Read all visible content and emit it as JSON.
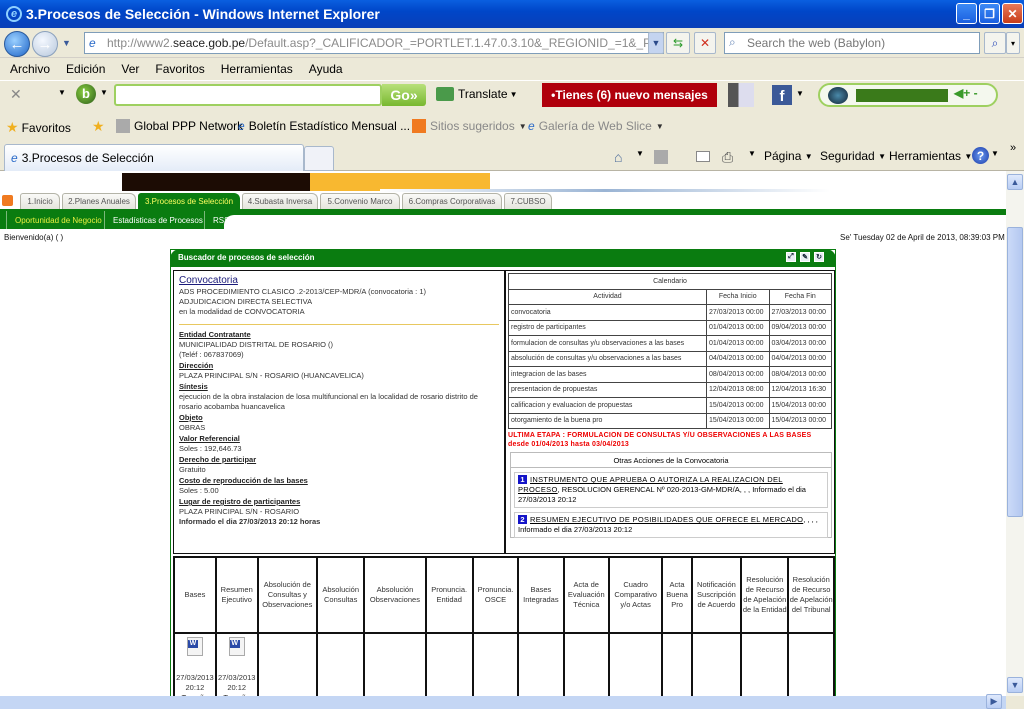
{
  "window": {
    "title": "3.Procesos de Selección - Windows Internet Explorer",
    "minimize": "_",
    "restore": "❐",
    "close": "✕"
  },
  "address": {
    "url_prefix": "http://www2.",
    "url_host": "seace.gob.pe",
    "url_rest": "/Default.asp?_CALIFICADOR_=PORTLET.1.47.0.3.10&_REGIONID_=1&_PORTLETI",
    "search_placeholder": "Search the web (Babylon)"
  },
  "menu": [
    "Archivo",
    "Edición",
    "Ver",
    "Favoritos",
    "Herramientas",
    "Ayuda"
  ],
  "babylon": {
    "go_label": "Go»",
    "translate_label": "Translate",
    "messages_label": "•Tienes (6) nuevo mensajes"
  },
  "favorites": {
    "favoritos_label": "Favoritos",
    "items": [
      "Global PPP Network",
      "Boletín Estadístico Mensual ...",
      "Sitios sugeridos",
      "Galería de Web Slice"
    ]
  },
  "browser_tab": {
    "label": "3.Procesos de Selección"
  },
  "command_bar": [
    "Página",
    "Seguridad",
    "Herramientas"
  ],
  "site": {
    "main_tabs": [
      "1.Inicio",
      "2.Planes Anuales",
      "3.Procesos de Selección",
      "4.Subasta Inversa",
      "5.Convenio Marco",
      "6.Compras Corporativas",
      "7.CUBSO"
    ],
    "active_tab": "3.Procesos de Selección",
    "sub_tabs": [
      "Oportunidad de Negocio",
      "Estadísticas de Procesos",
      "RSS"
    ],
    "welcome": "Bienvenido(a) ( )",
    "datetime": "Se' Tuesday 02 de April de 2013, 08:39:03 PM"
  },
  "panel": {
    "title": "Buscador de procesos de selección",
    "convocatoria_title": "Convocatoria",
    "process_code": "ADS PROCEDIMIENTO CLASICO .2-2013/CEP-MDR/A (convocatoria : 1)",
    "process_type": "ADJUDICACION DIRECTA SELECTIVA",
    "modality": "en la modalidad de CONVOCATORIA",
    "fields": [
      {
        "label": "Entidad Contratante",
        "value": "MUNICIPALIDAD DISTRITAL DE ROSARIO ()",
        "extra": "(Teléf : 067837069)"
      },
      {
        "label": "Dirección",
        "value": "PLAZA PRINCIPAL S/N - ROSARIO (HUANCAVELICA)"
      },
      {
        "label": "Síntesis",
        "value": "ejecucion de la obra instalacion de losa multifuncional en la localidad de rosario distrito de rosario acobamba huancavelica"
      },
      {
        "label": "Objeto",
        "value": "OBRAS"
      },
      {
        "label": "Valor Referencial",
        "value": "Soles : 192,646.73"
      },
      {
        "label": "Derecho de participar",
        "value": "Gratuito"
      },
      {
        "label": "Costo de reproducción de las bases",
        "value": "Soles : 5.00"
      },
      {
        "label": "Lugar de registro de participantes",
        "value": "PLAZA PRINCIPAL S/N - ROSARIO"
      }
    ],
    "informed": "Informado el dia 27/03/2013 20:12 horas",
    "calendar": {
      "title": "Calendario",
      "headers": [
        "Actividad",
        "Fecha Inicio",
        "Fecha Fin"
      ],
      "rows": [
        [
          "convocatoria",
          "27/03/2013 00:00",
          "27/03/2013 00:00"
        ],
        [
          "registro de participantes",
          "01/04/2013 00:00",
          "09/04/2013 00:00"
        ],
        [
          "formulacion de consultas y/u observaciones a las bases",
          "01/04/2013 00:00",
          "03/04/2013 00:00"
        ],
        [
          "absolución de consultas y/u observaciones a las bases",
          "04/04/2013 00:00",
          "04/04/2013 00:00"
        ],
        [
          "integracion de las bases",
          "08/04/2013 00:00",
          "08/04/2013 00:00"
        ],
        [
          "presentacion de propuestas",
          "12/04/2013 08:00",
          "12/04/2013 16:30"
        ],
        [
          "calificacion y evaluacion de propuestas",
          "15/04/2013 00:00",
          "15/04/2013 00:00"
        ],
        [
          "otorgamiento de la buena pro",
          "15/04/2013 00:00",
          "15/04/2013 00:00"
        ]
      ]
    },
    "ultima_etapa": "ULTIMA ETAPA : FORMULACION DE CONSULTAS Y/U OBSERVACIONES A LAS BASES",
    "ultima_rango": "desde 01/04/2013 hasta 03/04/2013",
    "otras": {
      "title": "Otras Acciones de la Convocatoria",
      "items": [
        {
          "num": "1",
          "link": "INSTRUMENTO QUE APRUEBA O AUTORIZA LA REALIZACION DEL PROCESO",
          "detail": ", RESOLUCION GERENCAL Nº 020-2013-GM-MDR/A, , , Informado el dia 27/03/2013 20:12"
        },
        {
          "num": "2",
          "link": "RESUMEN EJECUTIVO DE POSIBILIDADES QUE OFRECE EL MERCADO",
          "detail": ", , , , Informado el dia 27/03/2013 20:12"
        }
      ]
    },
    "docs_headers": [
      "Bases",
      "Resumen Ejecutivo",
      "Absolución de Consultas y Observaciones",
      "Absolución Consultas",
      "Absolución Observaciones",
      "Pronuncia. Entidad",
      "Pronuncia. OSCE",
      "Bases Integradas",
      "Acta de Evaluación Técnica",
      "Cuadro Comparativo y/o Actas",
      "Acta Buena Pro",
      "Notificación Suscripción de Acuerdo",
      "Resolución de Recurso de Apelación de la Entidad",
      "Resolución de Recurso de Apelación del Tribunal"
    ],
    "docs_files": [
      {
        "date": "27/03/2013",
        "time": "20:12",
        "size_label": "Tamaño"
      },
      {
        "date": "27/03/2013",
        "time": "20:12",
        "size_label": "Tamaño"
      }
    ]
  }
}
